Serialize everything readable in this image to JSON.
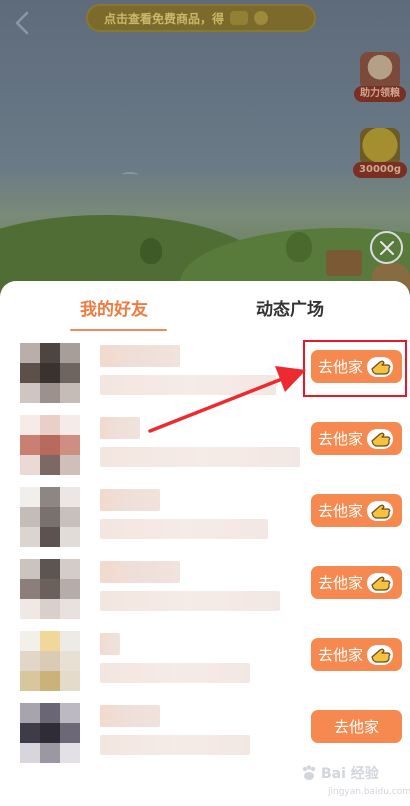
{
  "game": {
    "banner_text": "点击查看免费商品，得",
    "side_items": [
      {
        "label": "助力领粮"
      },
      {
        "label": "30000g"
      }
    ]
  },
  "sheet": {
    "tabs": [
      {
        "label": "我的好友",
        "active": true
      },
      {
        "label": "动态广场",
        "active": false
      }
    ],
    "friends": [
      {
        "visit_label": "去他家",
        "icon": "hand-point-icon",
        "avatar_colors": [
          "#b9aeaa",
          "#4e4440",
          "#a79d99",
          "#5d4f49",
          "#3a322e",
          "#6f6560",
          "#cfc6c3",
          "#9c918d",
          "#c5bbb7"
        ],
        "name_width": 80,
        "detail_width": 176
      },
      {
        "visit_label": "去他家",
        "icon": "hand-point-icon",
        "avatar_colors": [
          "#f6ebe8",
          "#e8cfc8",
          "#f5ebe8",
          "#c97f72",
          "#b86a5c",
          "#cf8e82",
          "#ead9d4",
          "#7c6864",
          "#cfbeb9"
        ],
        "name_width": 40,
        "detail_width": 200
      },
      {
        "visit_label": "去他家",
        "icon": "hand-point-icon",
        "avatar_colors": [
          "#f2eeec",
          "#8e8682",
          "#ece7e5",
          "#c4bcb8",
          "#7a716d",
          "#c8c0bc",
          "#dbd5d2",
          "#5c534f",
          "#e2dcd9"
        ],
        "name_width": 60,
        "detail_width": 168
      },
      {
        "visit_label": "去他家",
        "icon": "hand-point-icon",
        "avatar_colors": [
          "#cbc3bf",
          "#5e5450",
          "#d4ccc8",
          "#8c7f79",
          "#6b605b",
          "#b7ada8",
          "#efe8e5",
          "#d9d0cb",
          "#e8e1de"
        ],
        "name_width": 80,
        "detail_width": 180
      },
      {
        "visit_label": "去他家",
        "icon": "hand-point-icon",
        "avatar_colors": [
          "#f3efe9",
          "#f1d79a",
          "#eeeae6",
          "#e1d6c7",
          "#d9cbb4",
          "#e8e0d3",
          "#d8c79d",
          "#cab27a",
          "#e4dbc9"
        ],
        "name_width": 20,
        "detail_width": 150
      },
      {
        "visit_label": "去他家",
        "icon": "",
        "avatar_colors": [
          "#a7a4ad",
          "#6a6676",
          "#bdb9c2",
          "#3f3c49",
          "#2f2c38",
          "#6c6878",
          "#d8d5dc",
          "#9b97a3",
          "#e3e0e6"
        ],
        "name_width": 60,
        "detail_width": 150
      }
    ]
  },
  "annotation": {
    "highlight_color": "#e8182a"
  },
  "watermark": {
    "brand": "Bai 经验",
    "sub": "jingyan.baidu.com"
  }
}
